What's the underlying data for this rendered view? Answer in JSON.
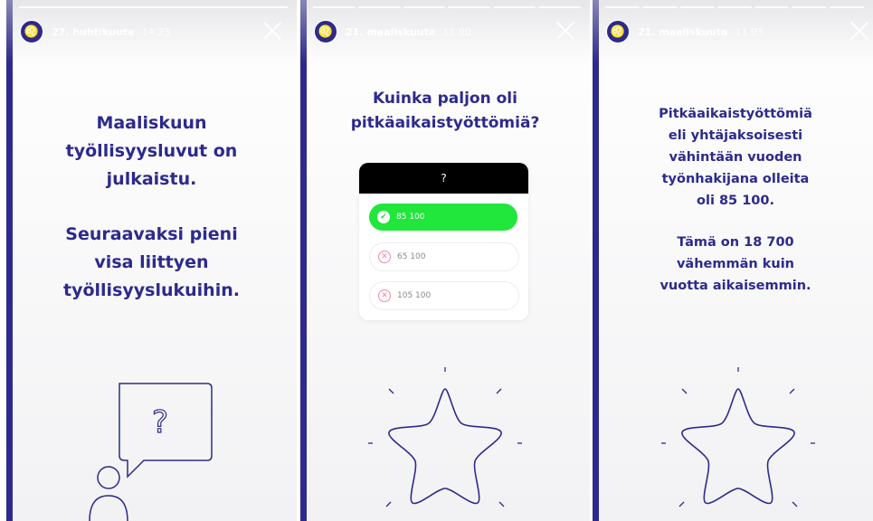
{
  "stories": [
    {
      "header": {
        "date": "27. huhtikuuta",
        "time": "14.23"
      },
      "lines_a": [
        "Maaliskuun",
        "työllisyysluvut on",
        "julkaistu."
      ],
      "lines_b": [
        "Seuraavaksi pieni",
        "visa liittyen",
        "työllisyyslukuihin."
      ],
      "bubble_symbol": "?"
    },
    {
      "header": {
        "date": "21. maaliskuuta",
        "time": "11.00"
      },
      "question_lines": [
        "Kuinka paljon oli",
        "pitkäaikaistyöttömiä?"
      ],
      "quiz": {
        "header_label": "?",
        "options": [
          {
            "label": "85 100",
            "state": "correct"
          },
          {
            "label": "65 100",
            "state": "wrong"
          },
          {
            "label": "105 100",
            "state": "wrong"
          }
        ]
      }
    },
    {
      "header": {
        "date": "21. maaliskuuta",
        "time": "11.03"
      },
      "lines_a": [
        "Pitkäaikaistyöttömiä",
        "eli yhtäjaksoisesti",
        "vähintään vuoden",
        "työnhakijana olleita",
        "oli 85 100."
      ],
      "lines_b": [
        "Tämä on 18 700",
        "vähemmän kuin",
        "vuotta aikaisemmin."
      ]
    }
  ],
  "colors": {
    "brand": "#2d2a8c",
    "correct": "#21e63b",
    "wrong": "#f08aa0"
  },
  "icons": {
    "close": "close-icon",
    "avatar": "lion-crest-icon",
    "star": "star-icon",
    "speech_bubble": "speech-bubble-icon",
    "person": "person-icon",
    "check": "check-icon",
    "wrong": "x-circle-icon"
  }
}
